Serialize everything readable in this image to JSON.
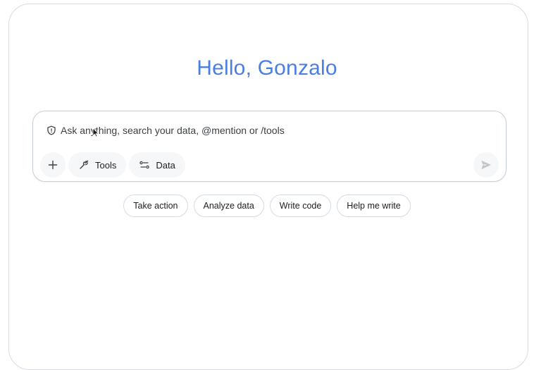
{
  "greeting": "Hello, Gonzalo",
  "prompt": {
    "placeholder": "Ask anything, search your data, @mention or /tools",
    "icon": "shield-icon"
  },
  "toolbar": {
    "add_icon": "plus-icon",
    "tools_label": "Tools",
    "tools_icon": "tools-sparkle-icon",
    "data_label": "Data",
    "data_icon": "data-filter-icon",
    "send_icon": "send-icon"
  },
  "suggestions": [
    {
      "label": "Take action"
    },
    {
      "label": "Analyze data"
    },
    {
      "label": "Write code"
    },
    {
      "label": "Help me write"
    }
  ],
  "colors": {
    "greeting": "#4a7fe0",
    "chip_bg": "#f6f7f9",
    "border": "#c9cdd6"
  }
}
